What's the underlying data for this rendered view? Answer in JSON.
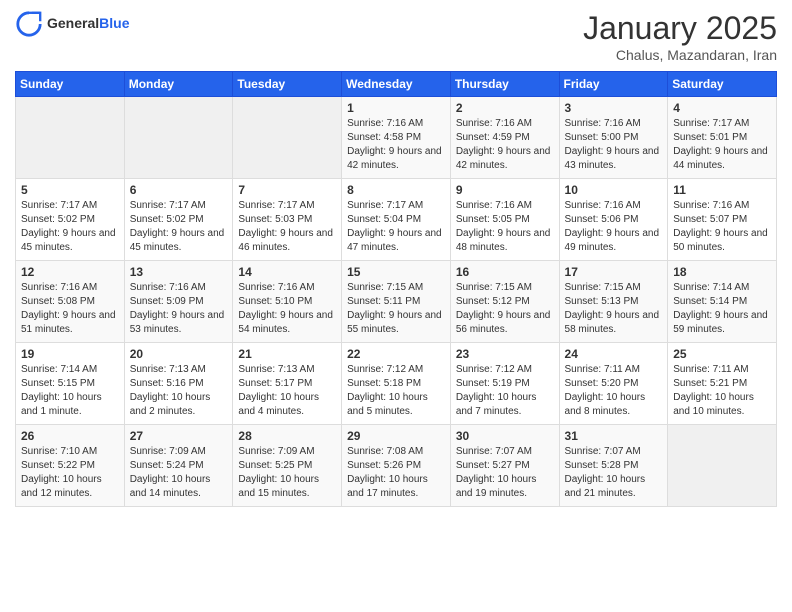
{
  "header": {
    "logo_general": "General",
    "logo_blue": "Blue",
    "month_title": "January 2025",
    "subtitle": "Chalus, Mazandaran, Iran"
  },
  "calendar": {
    "days_of_week": [
      "Sunday",
      "Monday",
      "Tuesday",
      "Wednesday",
      "Thursday",
      "Friday",
      "Saturday"
    ],
    "weeks": [
      [
        {
          "day": "",
          "text": ""
        },
        {
          "day": "",
          "text": ""
        },
        {
          "day": "",
          "text": ""
        },
        {
          "day": "1",
          "text": "Sunrise: 7:16 AM\nSunset: 4:58 PM\nDaylight: 9 hours and 42 minutes."
        },
        {
          "day": "2",
          "text": "Sunrise: 7:16 AM\nSunset: 4:59 PM\nDaylight: 9 hours and 42 minutes."
        },
        {
          "day": "3",
          "text": "Sunrise: 7:16 AM\nSunset: 5:00 PM\nDaylight: 9 hours and 43 minutes."
        },
        {
          "day": "4",
          "text": "Sunrise: 7:17 AM\nSunset: 5:01 PM\nDaylight: 9 hours and 44 minutes."
        }
      ],
      [
        {
          "day": "5",
          "text": "Sunrise: 7:17 AM\nSunset: 5:02 PM\nDaylight: 9 hours and 45 minutes."
        },
        {
          "day": "6",
          "text": "Sunrise: 7:17 AM\nSunset: 5:02 PM\nDaylight: 9 hours and 45 minutes."
        },
        {
          "day": "7",
          "text": "Sunrise: 7:17 AM\nSunset: 5:03 PM\nDaylight: 9 hours and 46 minutes."
        },
        {
          "day": "8",
          "text": "Sunrise: 7:17 AM\nSunset: 5:04 PM\nDaylight: 9 hours and 47 minutes."
        },
        {
          "day": "9",
          "text": "Sunrise: 7:16 AM\nSunset: 5:05 PM\nDaylight: 9 hours and 48 minutes."
        },
        {
          "day": "10",
          "text": "Sunrise: 7:16 AM\nSunset: 5:06 PM\nDaylight: 9 hours and 49 minutes."
        },
        {
          "day": "11",
          "text": "Sunrise: 7:16 AM\nSunset: 5:07 PM\nDaylight: 9 hours and 50 minutes."
        }
      ],
      [
        {
          "day": "12",
          "text": "Sunrise: 7:16 AM\nSunset: 5:08 PM\nDaylight: 9 hours and 51 minutes."
        },
        {
          "day": "13",
          "text": "Sunrise: 7:16 AM\nSunset: 5:09 PM\nDaylight: 9 hours and 53 minutes."
        },
        {
          "day": "14",
          "text": "Sunrise: 7:16 AM\nSunset: 5:10 PM\nDaylight: 9 hours and 54 minutes."
        },
        {
          "day": "15",
          "text": "Sunrise: 7:15 AM\nSunset: 5:11 PM\nDaylight: 9 hours and 55 minutes."
        },
        {
          "day": "16",
          "text": "Sunrise: 7:15 AM\nSunset: 5:12 PM\nDaylight: 9 hours and 56 minutes."
        },
        {
          "day": "17",
          "text": "Sunrise: 7:15 AM\nSunset: 5:13 PM\nDaylight: 9 hours and 58 minutes."
        },
        {
          "day": "18",
          "text": "Sunrise: 7:14 AM\nSunset: 5:14 PM\nDaylight: 9 hours and 59 minutes."
        }
      ],
      [
        {
          "day": "19",
          "text": "Sunrise: 7:14 AM\nSunset: 5:15 PM\nDaylight: 10 hours and 1 minute."
        },
        {
          "day": "20",
          "text": "Sunrise: 7:13 AM\nSunset: 5:16 PM\nDaylight: 10 hours and 2 minutes."
        },
        {
          "day": "21",
          "text": "Sunrise: 7:13 AM\nSunset: 5:17 PM\nDaylight: 10 hours and 4 minutes."
        },
        {
          "day": "22",
          "text": "Sunrise: 7:12 AM\nSunset: 5:18 PM\nDaylight: 10 hours and 5 minutes."
        },
        {
          "day": "23",
          "text": "Sunrise: 7:12 AM\nSunset: 5:19 PM\nDaylight: 10 hours and 7 minutes."
        },
        {
          "day": "24",
          "text": "Sunrise: 7:11 AM\nSunset: 5:20 PM\nDaylight: 10 hours and 8 minutes."
        },
        {
          "day": "25",
          "text": "Sunrise: 7:11 AM\nSunset: 5:21 PM\nDaylight: 10 hours and 10 minutes."
        }
      ],
      [
        {
          "day": "26",
          "text": "Sunrise: 7:10 AM\nSunset: 5:22 PM\nDaylight: 10 hours and 12 minutes."
        },
        {
          "day": "27",
          "text": "Sunrise: 7:09 AM\nSunset: 5:24 PM\nDaylight: 10 hours and 14 minutes."
        },
        {
          "day": "28",
          "text": "Sunrise: 7:09 AM\nSunset: 5:25 PM\nDaylight: 10 hours and 15 minutes."
        },
        {
          "day": "29",
          "text": "Sunrise: 7:08 AM\nSunset: 5:26 PM\nDaylight: 10 hours and 17 minutes."
        },
        {
          "day": "30",
          "text": "Sunrise: 7:07 AM\nSunset: 5:27 PM\nDaylight: 10 hours and 19 minutes."
        },
        {
          "day": "31",
          "text": "Sunrise: 7:07 AM\nSunset: 5:28 PM\nDaylight: 10 hours and 21 minutes."
        },
        {
          "day": "",
          "text": ""
        }
      ]
    ]
  }
}
